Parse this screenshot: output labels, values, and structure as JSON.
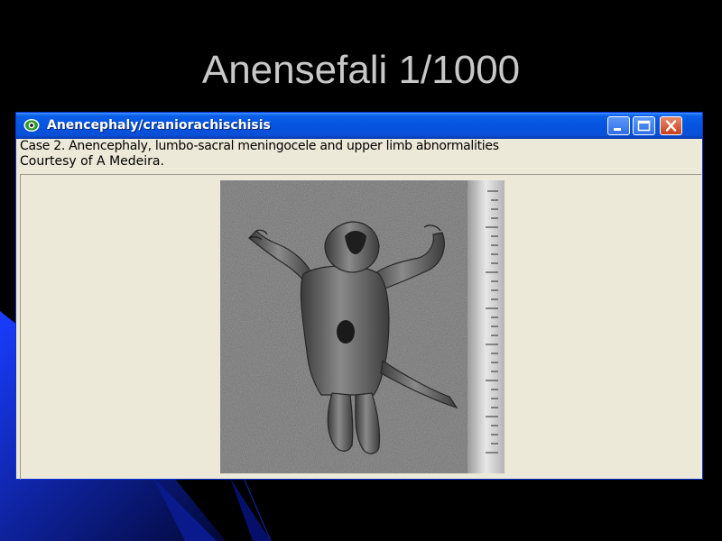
{
  "slide": {
    "title": "Anensefali 1/1000"
  },
  "window": {
    "title": "Anencephaly/craniorachischisis",
    "app_icon": "eye-globe-icon",
    "controls": {
      "minimize_icon": "minimize-icon",
      "maximize_icon": "maximize-icon",
      "close_icon": "close-icon"
    },
    "caption_line_1": "Case 2. Anencephaly, lumbo-sacral meningocele and upper limb abnormalities",
    "caption_line_2": "Courtesy of A Medeira."
  },
  "colors": {
    "slide_background": "#000000",
    "slide_accent": "#0a1fa8",
    "title_text": "#c8c8c8",
    "window_titlebar": "#0554e0",
    "window_body": "#ece9d8"
  }
}
